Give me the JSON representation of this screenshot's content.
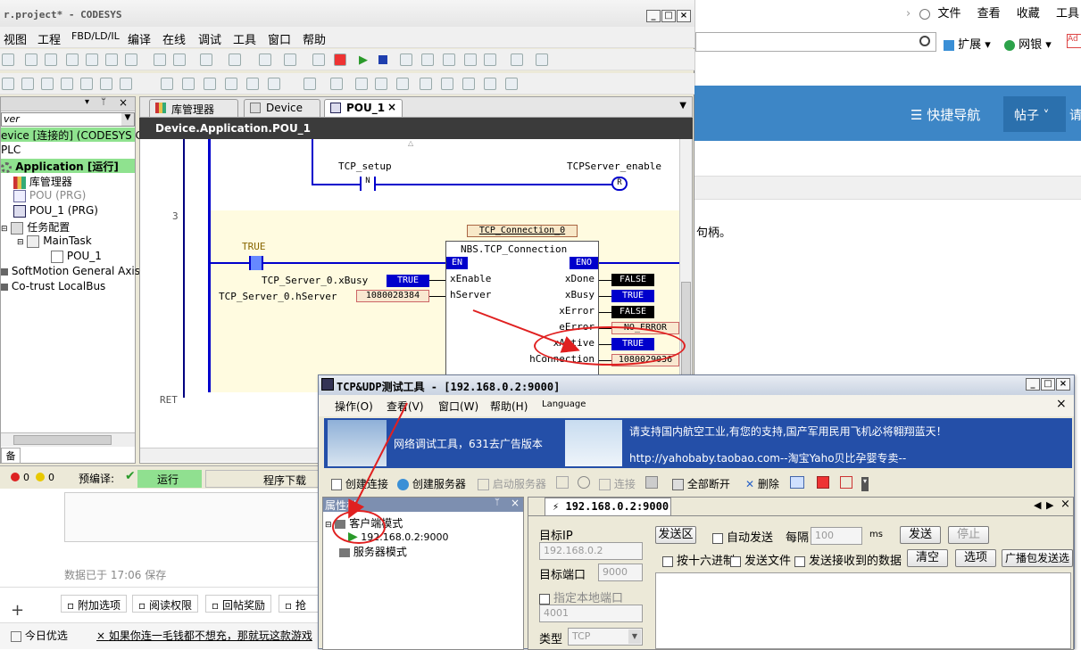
{
  "browser": {
    "top_links": [
      "文件",
      "查看",
      "收藏",
      "工具"
    ],
    "ext_label": "扩展",
    "bank_label": "网银",
    "nav_title": "快捷导航",
    "nav_item": "帖子",
    "nav_item2": "请",
    "page_text": "句柄。"
  },
  "forum": {
    "saved_text": "数据已于 17:06 保存",
    "options": [
      "附加选项",
      "阅读权限",
      "回帖奖励",
      "抢楼"
    ],
    "footer_left": "今日优选",
    "footer_right": "如果你连一毛钱都不想充，那就玩这款游戏"
  },
  "codesys": {
    "title": "r.project* - CODESYS",
    "menu": [
      "视图",
      "工程",
      "FBD/LD/IL",
      "编译",
      "在线",
      "调试",
      "工具",
      "窗口",
      "帮助"
    ],
    "tree": {
      "dropdown": "ver",
      "device": "evice [连接的] (CODESYS Control",
      "plc": "PLC",
      "application": "Application [运行]",
      "library": "库管理器",
      "pou": "POU (PRG)",
      "pou1": "POU_1 (PRG)",
      "task_config": "任务配置",
      "main_task": "MainTask",
      "main_task_pou": "POU_1",
      "softmotion": "SoftMotion General Axis Pool",
      "localbus": "Co-trust LocalBus"
    },
    "tabs": [
      "库管理器",
      "Device",
      "POU_1"
    ],
    "editor_header": "Device.Application.POU_1",
    "ladder": {
      "tcp_setup": "TCP_setup",
      "server_enable": "TCPServer_enable",
      "contact_n": "N",
      "coil_r": "R",
      "network_no": "3",
      "ret": "RET",
      "true_label": "TRUE",
      "fb_instance": "TCP_Connection_0",
      "fb_type": "NBS.TCP_Connection",
      "en": "EN",
      "eno": "ENO",
      "in1_var": "TCP_Server_0.xBusy",
      "in1_val": "TRUE",
      "in2_var": "TCP_Server_0.hServer",
      "in2_val": "1080028384",
      "in1_pin": "xEnable",
      "in2_pin": "hServer",
      "outputs": [
        {
          "pin": "xDone",
          "val": "FALSE"
        },
        {
          "pin": "xBusy",
          "val": "TRUE"
        },
        {
          "pin": "xError",
          "val": "FALSE"
        },
        {
          "pin": "eError",
          "val": "NO_ERROR"
        },
        {
          "pin": "xActive",
          "val": "TRUE"
        },
        {
          "pin": "hConnection",
          "val": "1080029036"
        }
      ]
    },
    "status": {
      "errors": "0",
      "warnings": "0",
      "precompile": "预编译:",
      "run": "运行",
      "download": "程序下载",
      "tab_left": "备"
    }
  },
  "tcp_tool": {
    "title": "TCP&UDP测试工具 - [192.168.0.2:9000]",
    "menu": [
      "操作(O)",
      "查看(V)",
      "窗口(W)",
      "帮助(H)",
      "Language"
    ],
    "banner_left": "网络调试工具，631去广告版本",
    "banner_right_top": "请支持国内航空工业,有您的支持,国产军用民用飞机必将翱翔蓝天！",
    "banner_right_bottom": "http://yahobaby.taobao.com--淘宝Yaho贝比孕婴专卖--",
    "toolbar": [
      "创建连接",
      "创建服务器",
      "启动服务器",
      "连接",
      "全部断开",
      "删除"
    ],
    "props_title": "属性栏",
    "client_mode": "客户端模式",
    "client_conn": "192.168.0.2:9000",
    "server_mode": "服务器模式",
    "conn_tab": "192.168.0.2:9000",
    "target_ip_label": "目标IP",
    "target_ip": "192.168.0.2",
    "target_port_label": "目标端口",
    "target_port": "9000",
    "local_port_label": "指定本地端口",
    "local_port": "4001",
    "type_label": "类型",
    "type_value": "TCP",
    "send_area": "发送区",
    "auto_send": "自动发送",
    "interval_label": "每隔",
    "interval_value": "100",
    "ms": "ms",
    "send_btn": "发送",
    "stop_btn": "停止",
    "hex_send": "按十六进制",
    "send_file": "发送文件",
    "send_received": "发送接收到的数据",
    "clear_btn": "清空",
    "options_btn": "选项",
    "broadcast_btn": "广播包发送选"
  }
}
